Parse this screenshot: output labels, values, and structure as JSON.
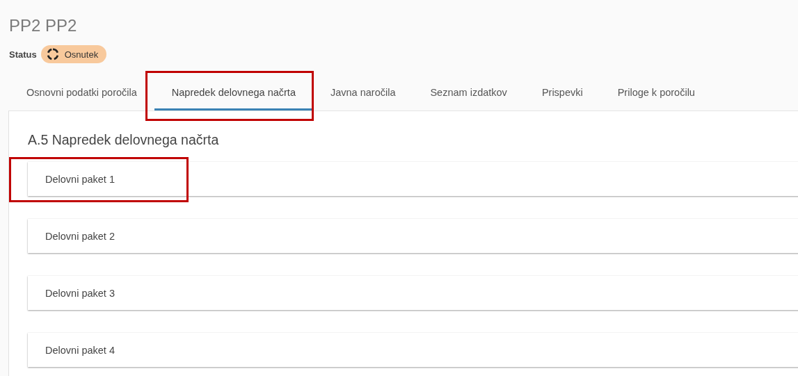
{
  "header": {
    "title": "PP2 PP2",
    "status_label": "Status",
    "status": {
      "label": "Osnutek"
    }
  },
  "tabs": [
    {
      "label": "Osnovni podatki poročila",
      "selected": false,
      "highlighted": false
    },
    {
      "label": "Napredek delovnega načrta",
      "selected": true,
      "highlighted": true
    },
    {
      "label": "Javna naročila",
      "selected": false,
      "highlighted": false
    },
    {
      "label": "Seznam izdatkov",
      "selected": false,
      "highlighted": false
    },
    {
      "label": "Prispevki",
      "selected": false,
      "highlighted": false
    },
    {
      "label": "Priloge k poročilu",
      "selected": false,
      "highlighted": false
    }
  ],
  "section": {
    "title": "A.5 Napredek delovnega načrta",
    "packages": [
      {
        "label": "Delovni paket 1",
        "highlighted": true
      },
      {
        "label": "Delovni paket 2",
        "highlighted": false
      },
      {
        "label": "Delovni paket 3",
        "highlighted": false
      },
      {
        "label": "Delovni paket 4",
        "highlighted": false
      }
    ]
  }
}
